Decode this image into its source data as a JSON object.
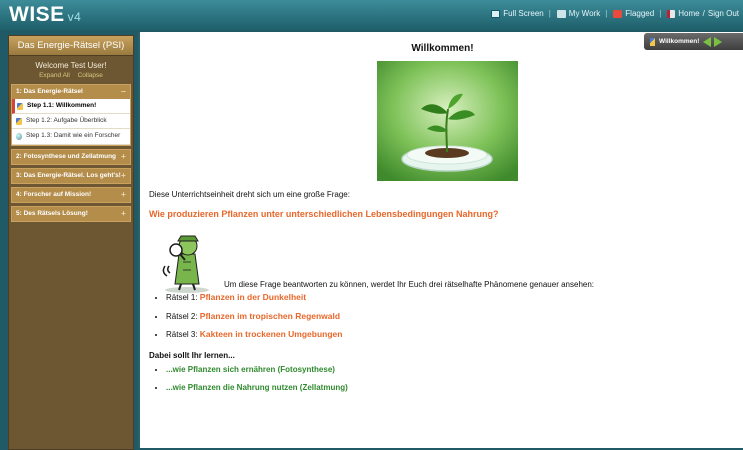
{
  "header": {
    "logo": "WISE",
    "version": "v4",
    "nav": [
      {
        "label": "Full Screen",
        "icon": "fullscreen-icon"
      },
      {
        "label": "My Work",
        "icon": "my-work-icon"
      },
      {
        "label": "Flagged",
        "icon": "flag-icon"
      },
      {
        "label": "Home",
        "icon": "home-icon"
      }
    ],
    "separator": "/",
    "signout": "Sign Out"
  },
  "sidebar": {
    "title": "Das Energie-Rätsel (PSI)",
    "welcome": "Welcome Test User!",
    "expand_all": "Expand All",
    "collapse": "Collapse",
    "activities": [
      {
        "label": "1: Das Energie-Rätsel",
        "toggle": "−",
        "steps": [
          {
            "label": "Step 1.1: Willkommen!",
            "icon": "pencil-icon"
          },
          {
            "label": "Step 1.2: Aufgabe Überblick",
            "icon": "pencil-icon"
          },
          {
            "label": "Step 1.3: Damit wie ein Forscher",
            "icon": "globe-icon"
          }
        ]
      },
      {
        "label": "2: Fotosynthese und Zellatmung",
        "toggle": "+"
      },
      {
        "label": "3: Das Energie-Rätsel. Los geht's!",
        "toggle": "+"
      },
      {
        "label": "4: Forscher auf Mission!",
        "toggle": "+"
      },
      {
        "label": "5: Des Rätsels Lösung!",
        "toggle": "+"
      }
    ]
  },
  "step_nav": {
    "label": "Willkommen!"
  },
  "content": {
    "title": "Willkommen!",
    "intro": "Diese Unterrichtseinheit dreht sich um eine große Frage:",
    "question": "Wie produzieren Pflanzen unter unterschiedlichen Lebensbedingungen Nahrung?",
    "explain": "Um diese Frage beantworten zu können, werdet Ihr Euch drei rätselhafte Phänomene genauer ansehen:",
    "raetsel": [
      {
        "prefix": "Rätsel 1: ",
        "text": "Pflanzen in der Dunkelheit"
      },
      {
        "prefix": "Rätsel 2: ",
        "text": "Pflanzen im tropischen Regenwald"
      },
      {
        "prefix": "Rätsel 3: ",
        "text": "Kakteen in trockenen Umgebungen"
      }
    ],
    "learn_heading": "Dabei sollt Ihr lernen...",
    "goals": [
      "...wie Pflanzen sich ernähren (Fotosynthese)",
      "...wie Pflanzen die Nahrung nutzen (Zellatmung)"
    ]
  },
  "colors": {
    "topbar": "#2a7583",
    "sidebar": "#6d5733",
    "accent_orange": "#e8672a",
    "accent_green": "#2f8a2e",
    "nav_arrow": "#7ac142"
  }
}
